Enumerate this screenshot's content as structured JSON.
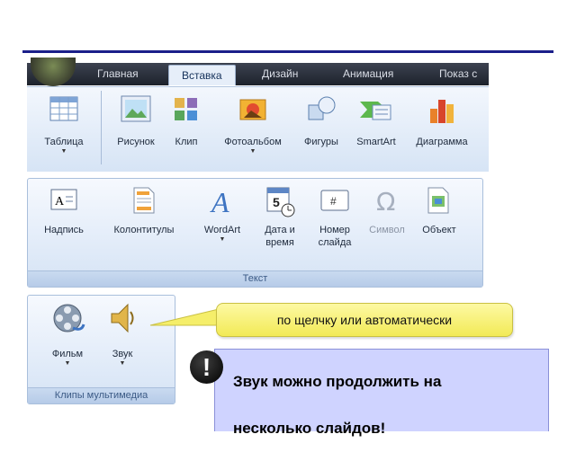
{
  "ribbon": {
    "tabs": [
      "Главная",
      "Вставка",
      "Дизайн",
      "Анимация",
      "Показ с"
    ],
    "active_tab": "Вставка",
    "top_buttons": [
      {
        "label": "Таблица",
        "dropdown": true
      },
      {
        "label": "Рисунок"
      },
      {
        "label": "Клип"
      },
      {
        "label": "Фотоальбом",
        "dropdown": true
      },
      {
        "label": "Фигуры"
      },
      {
        "label": "SmartArt"
      },
      {
        "label": "Диаграмма"
      }
    ],
    "text_group": {
      "caption": "Текст",
      "buttons": [
        {
          "label": "Надпись"
        },
        {
          "label": "Колонтитулы"
        },
        {
          "label": "WordArt",
          "dropdown": true
        },
        {
          "label1": "Дата и",
          "label2": "время"
        },
        {
          "label1": "Номер",
          "label2": "слайда"
        },
        {
          "label": "Символ",
          "disabled": true
        },
        {
          "label": "Объект"
        }
      ]
    },
    "media_group": {
      "caption": "Клипы мультимедиа",
      "buttons": [
        {
          "label": "Фильм",
          "dropdown": true
        },
        {
          "label": "Звук",
          "dropdown": true
        }
      ]
    }
  },
  "callout": {
    "text": "по щелчку или автоматически"
  },
  "note": {
    "badge": "!",
    "line1": "Звук можно продолжить на",
    "line2": "несколько слайдов!"
  },
  "colors": {
    "accent_rule": "#1b1f8a",
    "callout_fill": "#f2ea56",
    "note_fill": "#cfd3ff"
  }
}
